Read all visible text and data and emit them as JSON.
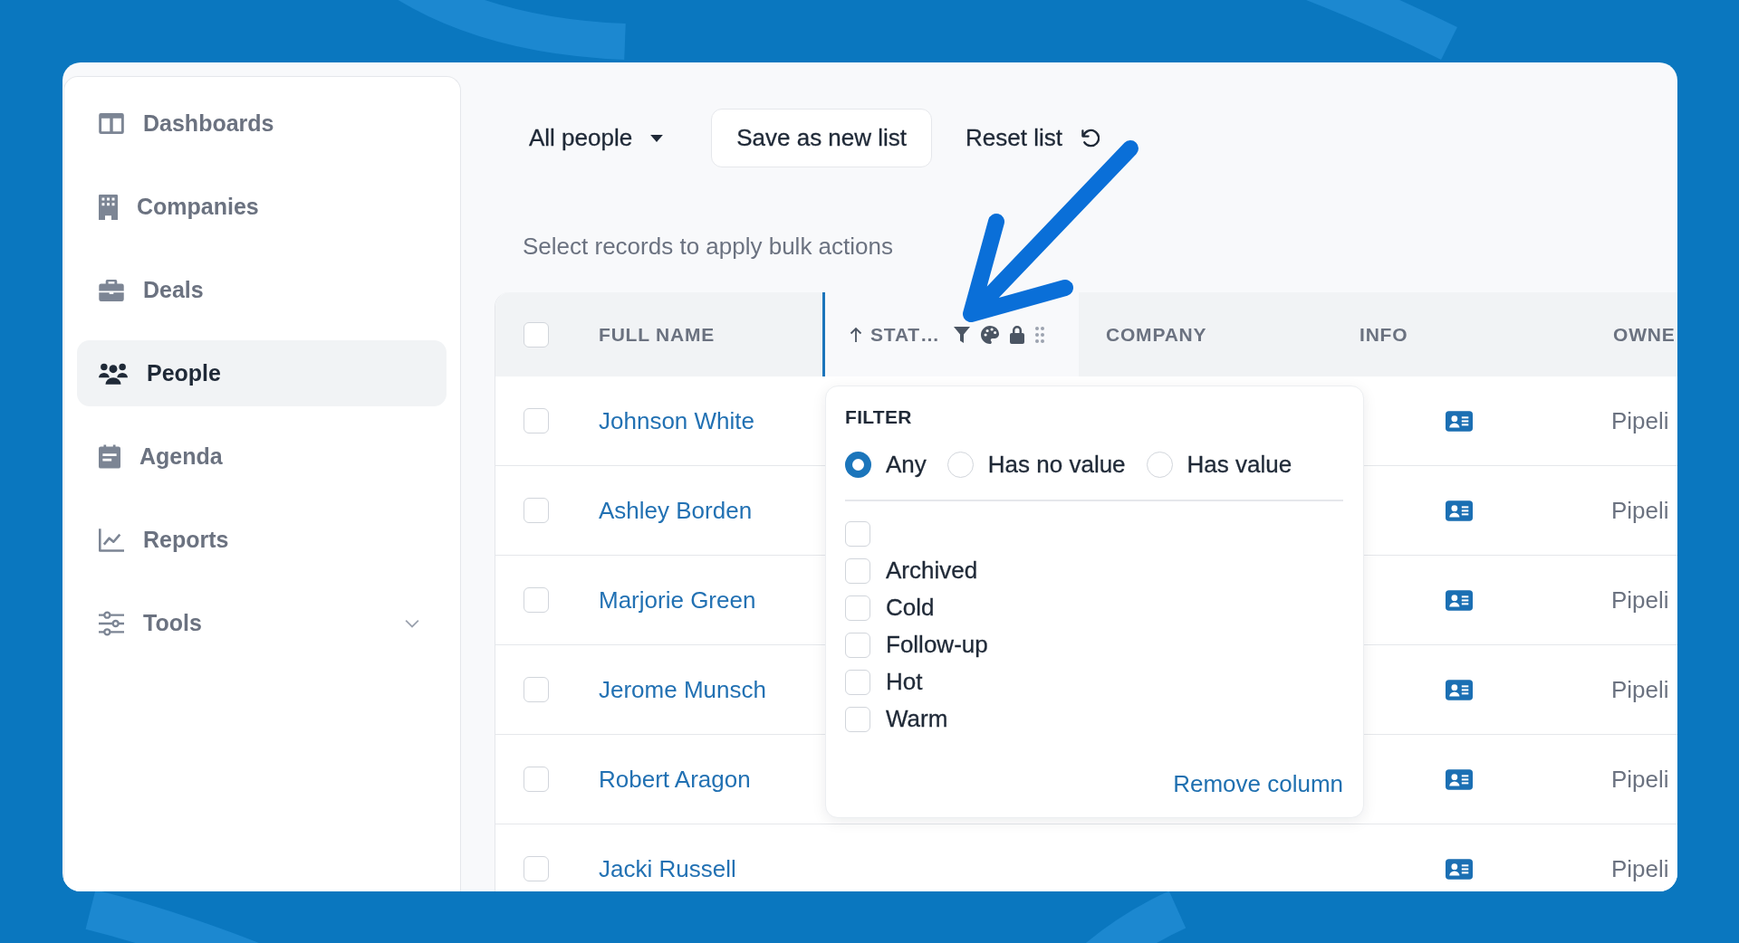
{
  "sidebar": {
    "items": [
      {
        "label": "Dashboards",
        "selected": false,
        "kind": "link"
      },
      {
        "label": "Companies",
        "selected": false,
        "kind": "link"
      },
      {
        "label": "Deals",
        "selected": false,
        "kind": "link"
      },
      {
        "label": "People",
        "selected": true,
        "kind": "link"
      },
      {
        "label": "Agenda",
        "selected": false,
        "kind": "link"
      },
      {
        "label": "Reports",
        "selected": false,
        "kind": "link"
      },
      {
        "label": "Tools",
        "selected": false,
        "kind": "group"
      }
    ]
  },
  "toolbar": {
    "list_selector": "All people",
    "save_button": "Save as new list",
    "reset_button": "Reset list"
  },
  "bulk_hint": "Select records to apply bulk actions",
  "table": {
    "select_all": {
      "checked": false
    },
    "columns": [
      {
        "label": "FULL NAME",
        "selected": false,
        "sorted": false
      },
      {
        "label": "STAT…",
        "selected": true,
        "sorted": true
      },
      {
        "label": "COMPANY",
        "selected": false,
        "sorted": false
      },
      {
        "label": "INFO",
        "selected": false,
        "sorted": false
      },
      {
        "label": "OWNE",
        "selected": false,
        "sorted": false
      }
    ],
    "rows": [
      {
        "checked": false,
        "name": "Johnson White",
        "owner": "Pipeli"
      },
      {
        "checked": false,
        "name": "Ashley Borden",
        "owner": "Pipeli"
      },
      {
        "checked": false,
        "name": "Marjorie Green",
        "owner": "Pipeli"
      },
      {
        "checked": false,
        "name": "Jerome Munsch",
        "owner": "Pipeli"
      },
      {
        "checked": false,
        "name": "Robert Aragon",
        "owner": "Pipeli"
      },
      {
        "checked": false,
        "name": "Jacki Russell",
        "owner": "Pipeli"
      }
    ]
  },
  "filter_popup": {
    "title": "FILTER",
    "modes": [
      {
        "label": "Any",
        "selected": true
      },
      {
        "label": "Has no value",
        "selected": false
      },
      {
        "label": "Has value",
        "selected": false
      }
    ],
    "options": [
      {
        "checked": false
      },
      {
        "label": "Archived",
        "checked": false
      },
      {
        "label": "Cold",
        "checked": false
      },
      {
        "label": "Follow-up",
        "checked": false
      },
      {
        "label": "Hot",
        "checked": false
      },
      {
        "label": "Warm",
        "checked": false
      }
    ],
    "remove_link": "Remove column"
  }
}
